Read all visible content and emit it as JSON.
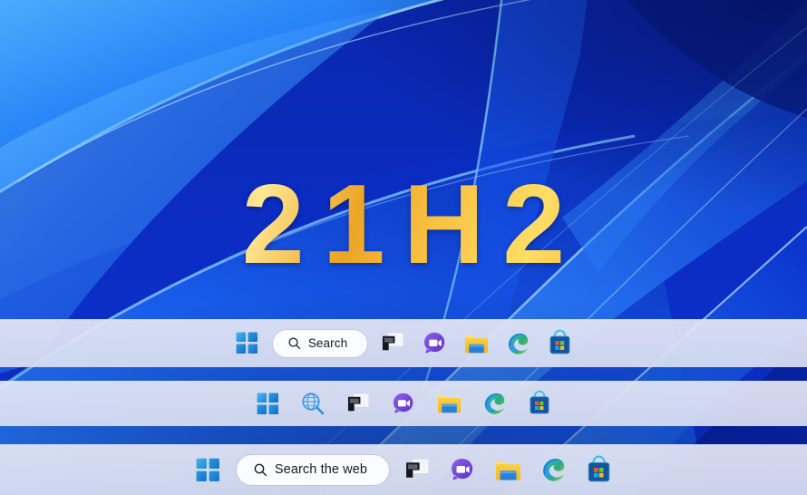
{
  "wallpaper": {
    "name": "windows-11-bloom-blue",
    "base_color": "#0b31d0",
    "accent_color": "#3da0ff",
    "deep_color": "#061a86"
  },
  "overlay_title": {
    "text": "21H2",
    "gradient_from": "#ffe27a",
    "gradient_to": "#eca425"
  },
  "taskbars": [
    {
      "id": "taskbar-search-pill",
      "search": {
        "type": "pill",
        "label": "Search",
        "icon": "search-icon"
      },
      "items": [
        {
          "name": "start-button",
          "label": "Start",
          "icon": "windows-logo-icon"
        },
        {
          "name": "task-view-button",
          "label": "Task view",
          "icon": "task-view-icon"
        },
        {
          "name": "chat-button",
          "label": "Chat",
          "icon": "chat-teams-icon"
        },
        {
          "name": "file-explorer-button",
          "label": "File Explorer",
          "icon": "folder-icon"
        },
        {
          "name": "edge-button",
          "label": "Microsoft Edge",
          "icon": "edge-icon"
        },
        {
          "name": "store-button",
          "label": "Microsoft Store",
          "icon": "store-bag-icon"
        }
      ]
    },
    {
      "id": "taskbar-search-icon",
      "search": {
        "type": "icon",
        "label": "",
        "icon": "search-web-globe-icon"
      },
      "items": [
        {
          "name": "start-button",
          "label": "Start",
          "icon": "windows-logo-icon"
        },
        {
          "name": "task-view-button",
          "label": "Task view",
          "icon": "task-view-icon"
        },
        {
          "name": "chat-button",
          "label": "Chat",
          "icon": "chat-teams-icon"
        },
        {
          "name": "file-explorer-button",
          "label": "File Explorer",
          "icon": "folder-icon"
        },
        {
          "name": "edge-button",
          "label": "Microsoft Edge",
          "icon": "edge-icon"
        },
        {
          "name": "store-button",
          "label": "Microsoft Store",
          "icon": "store-bag-icon"
        }
      ]
    },
    {
      "id": "taskbar-search-the-web",
      "search": {
        "type": "pill",
        "label": "Search the web",
        "icon": "search-icon"
      },
      "items": [
        {
          "name": "start-button",
          "label": "Start",
          "icon": "windows-logo-icon"
        },
        {
          "name": "task-view-button",
          "label": "Task view",
          "icon": "task-view-icon"
        },
        {
          "name": "chat-button",
          "label": "Chat",
          "icon": "chat-teams-icon"
        },
        {
          "name": "file-explorer-button",
          "label": "File Explorer",
          "icon": "folder-icon"
        },
        {
          "name": "edge-button",
          "label": "Microsoft Edge",
          "icon": "edge-icon"
        },
        {
          "name": "store-button",
          "label": "Microsoft Store",
          "icon": "store-bag-icon"
        }
      ]
    }
  ]
}
